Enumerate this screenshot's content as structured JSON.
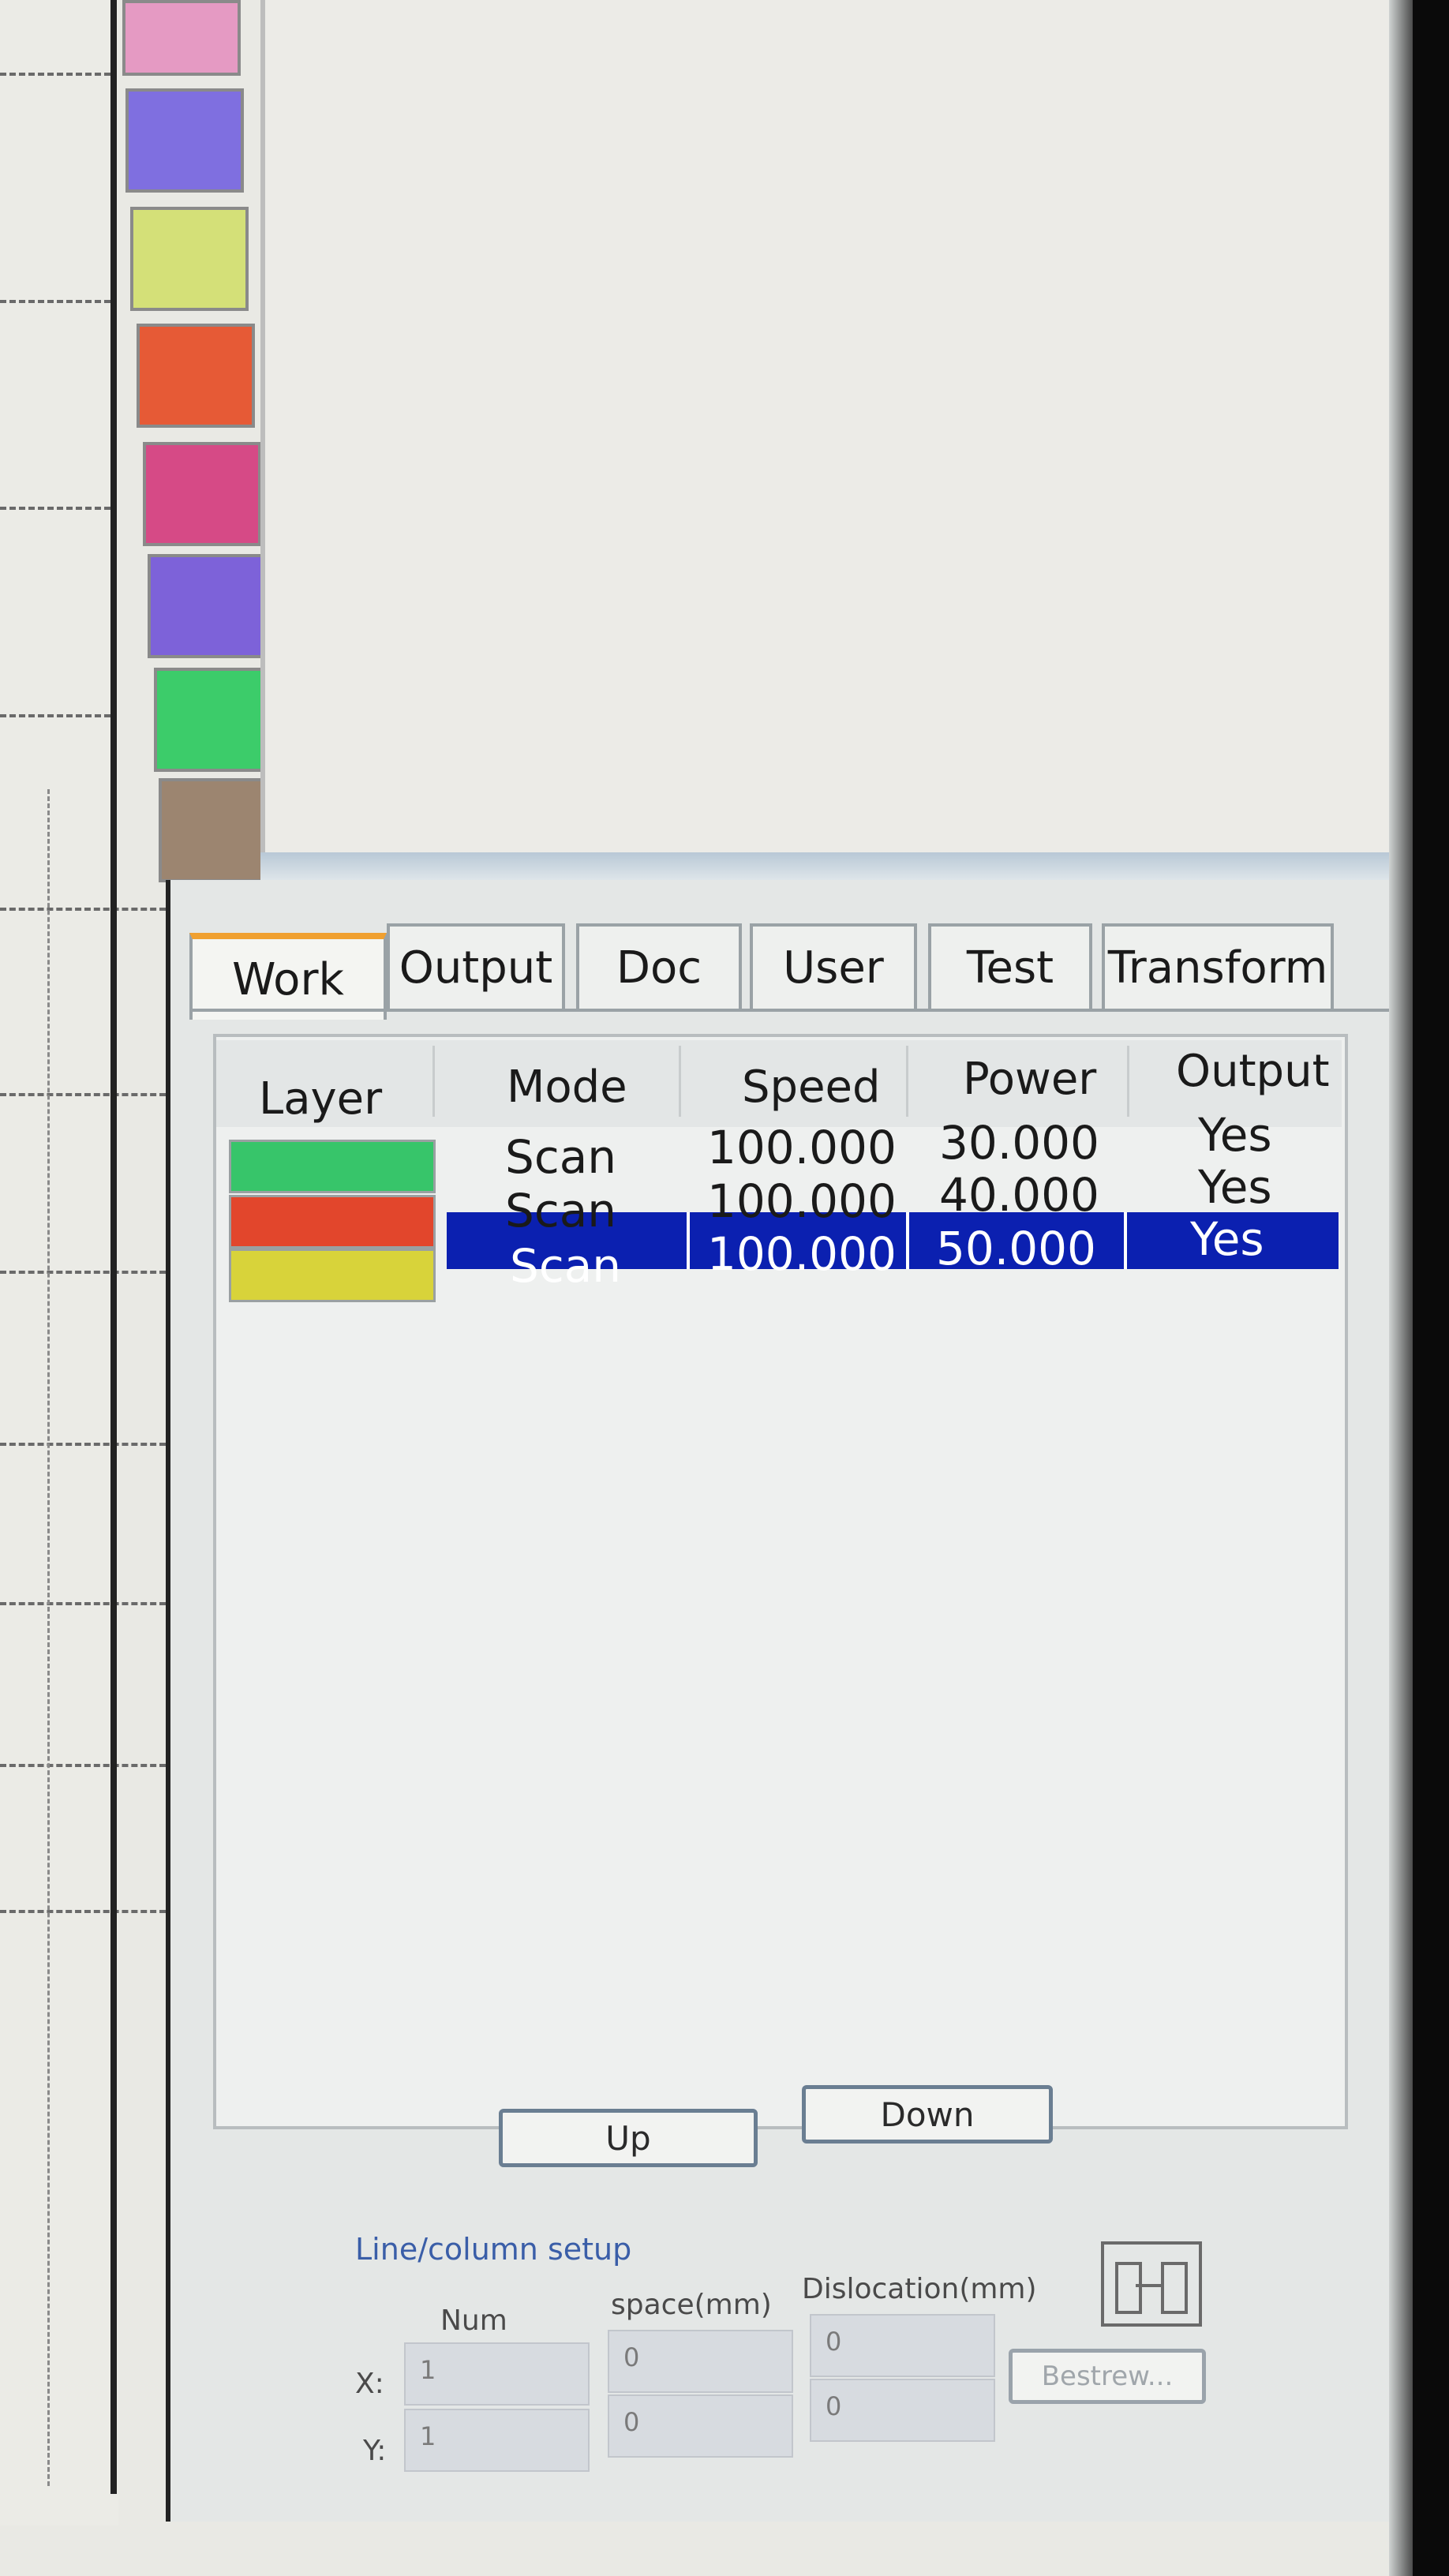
{
  "palette": {
    "swatches": [
      {
        "color": "#e59ac3"
      },
      {
        "color": "#7f6fe0"
      },
      {
        "color": "#d4e078"
      },
      {
        "color": "#e65a36"
      },
      {
        "color": "#d64a86"
      },
      {
        "color": "#7d62d9"
      },
      {
        "color": "#3ccc6a"
      },
      {
        "color": "#9c8570"
      }
    ]
  },
  "tabs": [
    {
      "label": "Work",
      "active": true
    },
    {
      "label": "Output",
      "active": false
    },
    {
      "label": "Doc",
      "active": false
    },
    {
      "label": "User",
      "active": false
    },
    {
      "label": "Test",
      "active": false
    },
    {
      "label": "Transform",
      "active": false
    }
  ],
  "layer_table": {
    "headers": {
      "layer": "Layer",
      "mode": "Mode",
      "speed": "Speed",
      "power": "Power",
      "output": "Output"
    },
    "rows": [
      {
        "color": "#37c56a",
        "mode": "Scan",
        "speed": "100.000",
        "power": "30.000",
        "output": "Yes",
        "selected": false
      },
      {
        "color": "#e2462c",
        "mode": "Scan",
        "speed": "100.000",
        "power": "40.000",
        "output": "Yes",
        "selected": false
      },
      {
        "color": "#d8d33a",
        "mode": "Scan",
        "speed": "100.000",
        "power": "50.000",
        "output": "Yes",
        "selected": true
      }
    ],
    "selection_color": "#0b20b0"
  },
  "buttons": {
    "up": "Up",
    "down": "Down",
    "bestrew": "Bestrew..."
  },
  "line_column_setup": {
    "title": "Line/column setup",
    "col_num": "Num",
    "col_space": "space(mm)",
    "col_dislocation": "Dislocation(mm)",
    "x_label": "X:",
    "y_label": "Y:",
    "x_num": "1",
    "y_num": "1",
    "x_space": "0",
    "y_space": "0",
    "x_dislocation": "0",
    "y_dislocation": "0"
  }
}
